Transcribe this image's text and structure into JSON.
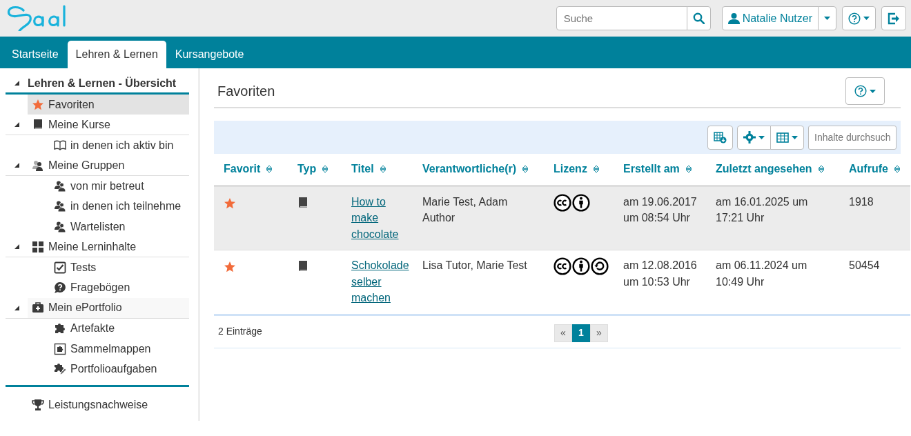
{
  "header": {
    "search": {
      "placeholder": "Suche"
    },
    "user_menu": {
      "label": "Natalie Nutzer"
    }
  },
  "tabs": [
    {
      "label": "Startseite",
      "selected": false
    },
    {
      "label": "Lehren & Lernen",
      "selected": true
    },
    {
      "label": "Kursangebote",
      "selected": false
    }
  ],
  "sidebar": {
    "title": "Lehren & Lernen - Übersicht",
    "expanded": true,
    "items": [
      {
        "kind": "star",
        "label": "Favoriten",
        "selected": true
      },
      {
        "kind": "book",
        "label": "Meine Kurse",
        "selected": false,
        "expanded": true,
        "children": [
          {
            "kind": "openbook",
            "label": "in denen ich aktiv bin",
            "selected": false
          }
        ]
      },
      {
        "kind": "groupgrey",
        "label": "Meine Gruppen",
        "selected": false,
        "expanded": true,
        "children": [
          {
            "kind": "group",
            "label": "von mir betreut",
            "selected": false
          },
          {
            "kind": "group",
            "label": "in denen ich teilnehme",
            "selected": false
          },
          {
            "kind": "group",
            "label": "Wartelisten",
            "selected": false
          }
        ]
      },
      {
        "kind": "grid",
        "label": "Meine Lerninhalte",
        "selected": false,
        "expanded": true,
        "children": [
          {
            "kind": "check",
            "label": "Tests",
            "selected": false
          },
          {
            "kind": "question",
            "label": "Fragebögen",
            "selected": false
          }
        ]
      },
      {
        "kind": "case",
        "label": "Mein ePortfolio",
        "selected": false,
        "expanded": true,
        "children": [
          {
            "kind": "puzzle",
            "label": "Artefakte",
            "selected": false
          },
          {
            "kind": "framed",
            "label": "Sammelmappen",
            "selected": false
          },
          {
            "kind": "puzzlepen",
            "label": "Portfolioaufgaben",
            "selected": false
          }
        ]
      }
    ],
    "footer_items": [
      {
        "kind": "trophy",
        "label": "Leistungsnachweise",
        "selected": false
      }
    ]
  },
  "main": {
    "title": "Favoriten",
    "table": {
      "search": {
        "placeholder": "Inhalte durchsuch"
      },
      "columns": [
        "Favorit",
        "Typ",
        "Titel",
        "Verantwortliche(r)",
        "Lizenz",
        "Erstellt am",
        "Zuletzt angesehen",
        "Aufrufe"
      ],
      "rows": [
        {
          "selected": true,
          "favorite": true,
          "title": "How to make chocolate",
          "responsible": "Marie Test, Adam Author",
          "license": [
            {
              "kind": "cc"
            },
            {
              "kind": "by"
            }
          ],
          "created": "am 19.06.2017 um 08:54 Uhr",
          "last_viewed": "am 16.01.2025 um 17:21 Uhr",
          "views": "1918"
        },
        {
          "selected": false,
          "favorite": true,
          "title": "Schokolade selber machen",
          "responsible": "Lisa Tutor, Marie Test",
          "license": [
            {
              "kind": "cc"
            },
            {
              "kind": "by"
            },
            {
              "kind": "sa"
            }
          ],
          "created": "am 12.08.2016 um 10:53 Uhr",
          "last_viewed": "am 06.11.2024 um 10:49 Uhr",
          "views": "50454"
        }
      ],
      "count": "2 Einträge",
      "pagination": [
        {
          "label": "«",
          "selected": false
        },
        {
          "label": "1",
          "selected": true
        },
        {
          "label": "»",
          "selected": false
        }
      ]
    }
  }
}
